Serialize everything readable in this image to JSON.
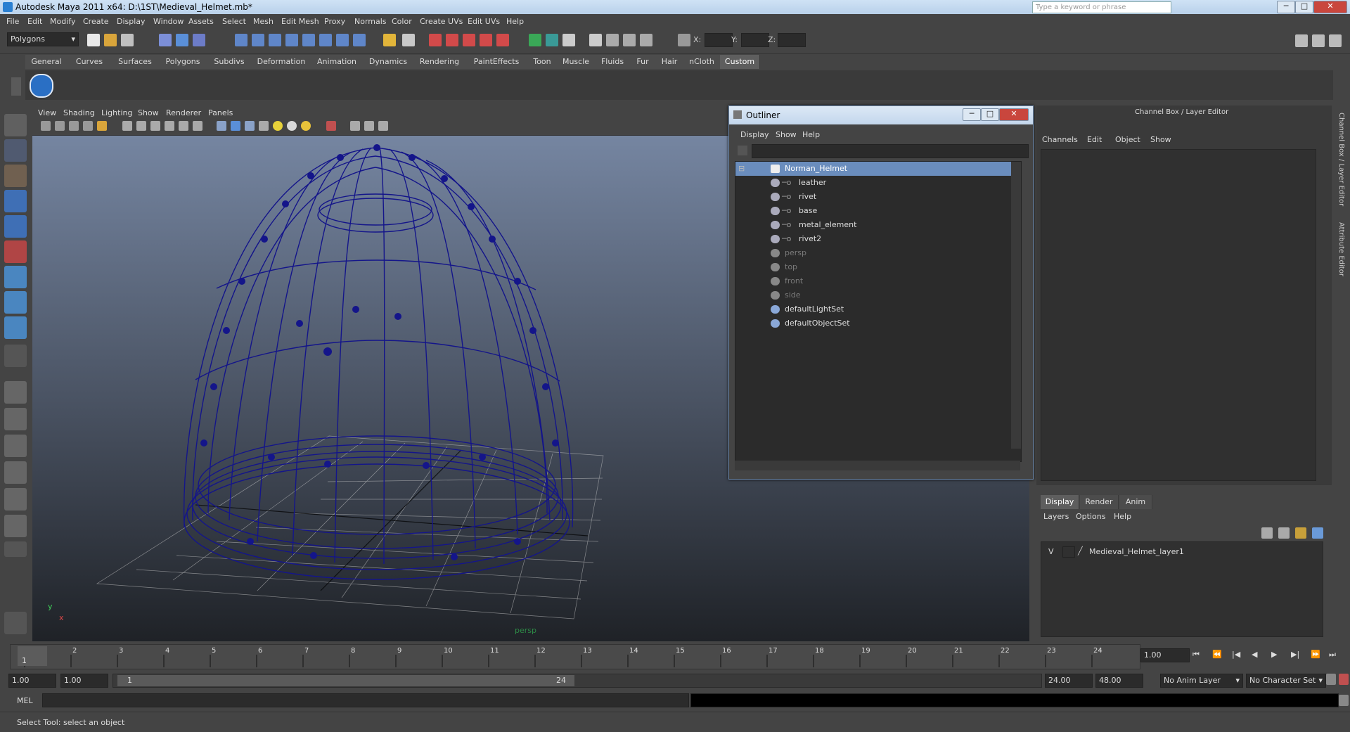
{
  "window": {
    "title": "Autodesk Maya 2011 x64: D:\\1ST\\Medieval_Helmet.mb*",
    "search_placeholder": "Type a keyword or phrase",
    "btn_min": "─",
    "btn_max": "□",
    "btn_close": "✕"
  },
  "menubar": [
    "File",
    "Edit",
    "Modify",
    "Create",
    "Display",
    "Window",
    "Assets",
    "Select",
    "Mesh",
    "Edit Mesh",
    "Proxy",
    "Normals",
    "Color",
    "Create UVs",
    "Edit UVs",
    "Help"
  ],
  "statusline": {
    "mode": "Polygons",
    "x_label": "X:",
    "y_label": "Y:",
    "z_label": "Z:"
  },
  "shelf": {
    "tabs": [
      "General",
      "Curves",
      "Surfaces",
      "Polygons",
      "Subdivs",
      "Deformation",
      "Animation",
      "Dynamics",
      "Rendering",
      "PaintEffects",
      "Toon",
      "Muscle",
      "Fluids",
      "Fur",
      "Hair",
      "nCloth",
      "Custom"
    ],
    "active": "Custom"
  },
  "viewport": {
    "menus": [
      "View",
      "Shading",
      "Lighting",
      "Show",
      "Renderer",
      "Panels"
    ],
    "camera_label": "persp",
    "axis_y": "y",
    "axis_x": "x"
  },
  "outliner": {
    "title": "Outliner",
    "menus": [
      "Display",
      "Show",
      "Help"
    ],
    "items": [
      {
        "label": "Norman_Helmet",
        "indent": 0,
        "selected": true,
        "dim": false,
        "expander": "⊟"
      },
      {
        "label": "leather",
        "indent": 1,
        "selected": false,
        "dim": false
      },
      {
        "label": "rivet",
        "indent": 1,
        "selected": false,
        "dim": false
      },
      {
        "label": "base",
        "indent": 1,
        "selected": false,
        "dim": false
      },
      {
        "label": "metal_element",
        "indent": 1,
        "selected": false,
        "dim": false
      },
      {
        "label": "rivet2",
        "indent": 1,
        "selected": false,
        "dim": false
      },
      {
        "label": "persp",
        "indent": 0,
        "selected": false,
        "dim": true
      },
      {
        "label": "top",
        "indent": 0,
        "selected": false,
        "dim": true
      },
      {
        "label": "front",
        "indent": 0,
        "selected": false,
        "dim": true
      },
      {
        "label": "side",
        "indent": 0,
        "selected": false,
        "dim": true
      },
      {
        "label": "defaultLightSet",
        "indent": 0,
        "selected": false,
        "dim": false
      },
      {
        "label": "defaultObjectSet",
        "indent": 0,
        "selected": false,
        "dim": false
      }
    ]
  },
  "channelbox": {
    "title": "Channel Box / Layer Editor",
    "menus": [
      "Channels",
      "Edit",
      "Object",
      "Show"
    ],
    "side_tab_1": "Channel Box / Layer Editor",
    "side_tab_2": "Attribute Editor"
  },
  "layereditor": {
    "tabs": [
      "Display",
      "Render",
      "Anim"
    ],
    "active": "Display",
    "menus": [
      "Layers",
      "Options",
      "Help"
    ],
    "layer": {
      "visibility": "V",
      "name": "Medieval_Helmet_layer1"
    }
  },
  "timeslider": {
    "ticks": [
      "1",
      "2",
      "3",
      "4",
      "5",
      "6",
      "7",
      "8",
      "9",
      "10",
      "11",
      "12",
      "13",
      "14",
      "15",
      "16",
      "17",
      "18",
      "19",
      "20",
      "21",
      "22",
      "23",
      "24"
    ],
    "current_frame_label": "1",
    "current_time": "1.00"
  },
  "rangeslider": {
    "start_time": "1.00",
    "playback_start": "1.00",
    "range_start_label": "1",
    "range_end_label": "24",
    "playback_end": "24.00",
    "end_time": "48.00",
    "anim_layer": "No Anim Layer",
    "character_set": "No Character Set"
  },
  "cmdline": {
    "label": "MEL"
  },
  "helpline": {
    "text": "Select Tool: select an object"
  },
  "colors": {
    "wire": "#14158a",
    "selection": "#6a8dbd"
  }
}
